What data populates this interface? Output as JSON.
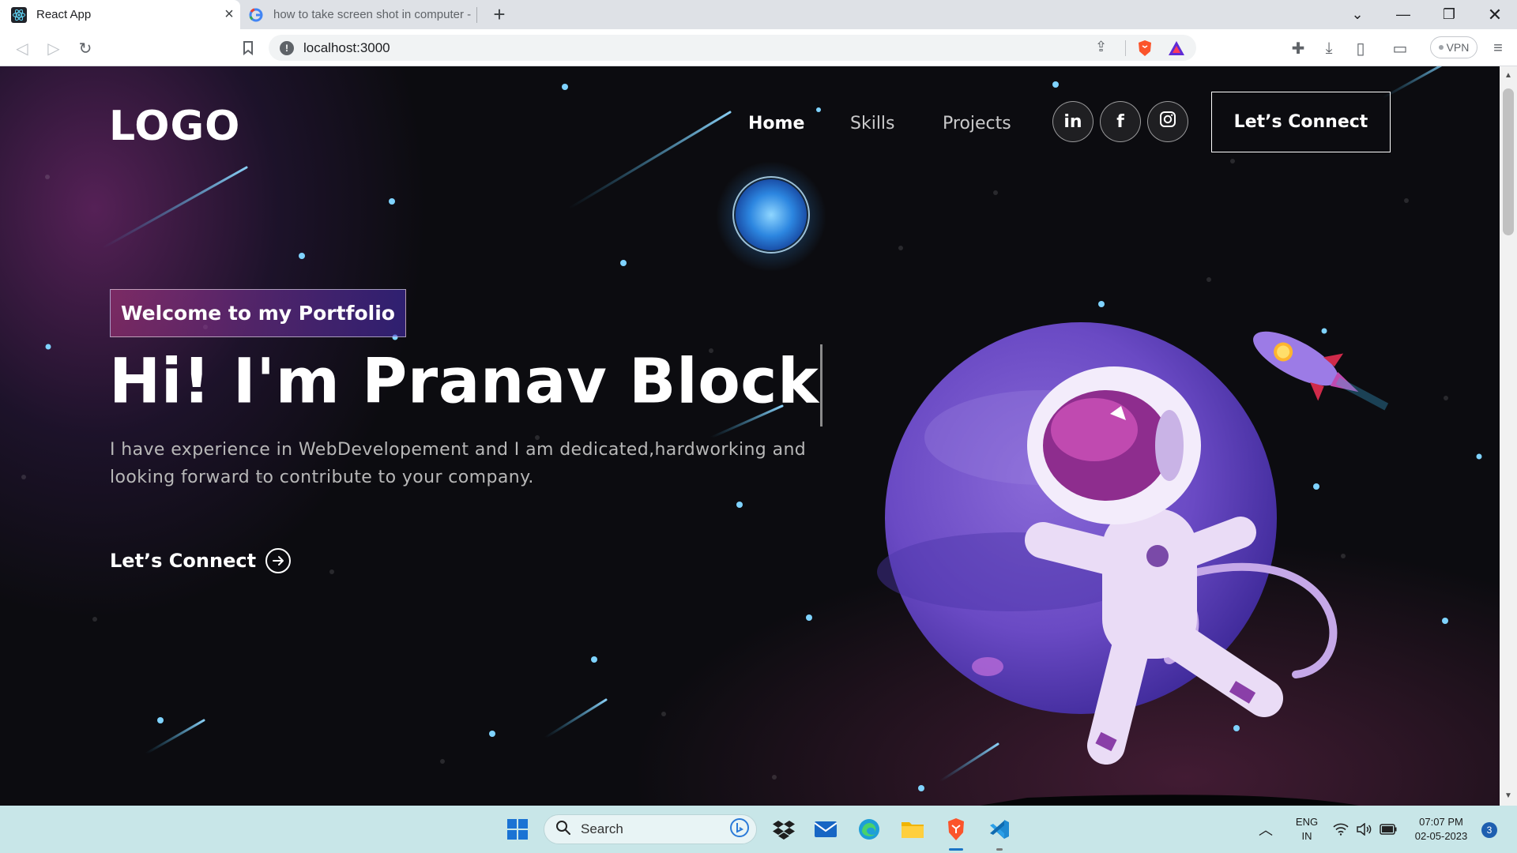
{
  "browser": {
    "tabs": [
      {
        "title": "React App",
        "active": true
      },
      {
        "title": "how to take screen shot in computer -",
        "active": false
      }
    ],
    "address": "localhost:3000",
    "vpn_label": "VPN"
  },
  "site": {
    "logo": "LOGO",
    "nav": {
      "home": "Home",
      "skills": "Skills",
      "projects": "Projects"
    },
    "social": [
      {
        "name": "linkedin",
        "glyph": "in"
      },
      {
        "name": "facebook",
        "glyph": "f"
      },
      {
        "name": "instagram",
        "glyph": ""
      }
    ],
    "connect_button": "Let’s Connect",
    "hero": {
      "tagline": "Welcome to my Portfolio",
      "headline": "Hi! I'm Pranav Block",
      "description": "I have experience in WebDevelopement and I am dedicated,hardworking and looking forward to contribute to your company.",
      "cta": "Let’s Connect"
    }
  },
  "taskbar": {
    "search_label": "Search",
    "lang_line1": "ENG",
    "lang_line2": "IN",
    "time": "07:07 PM",
    "date": "02-05-2023",
    "notification_count": "3"
  },
  "colors": {
    "brand_gradient_start": "#aa367c",
    "brand_gradient_end": "#4a2fbd",
    "page_bg": "#0c0c10",
    "taskbar_bg": "#c8e6e8"
  }
}
